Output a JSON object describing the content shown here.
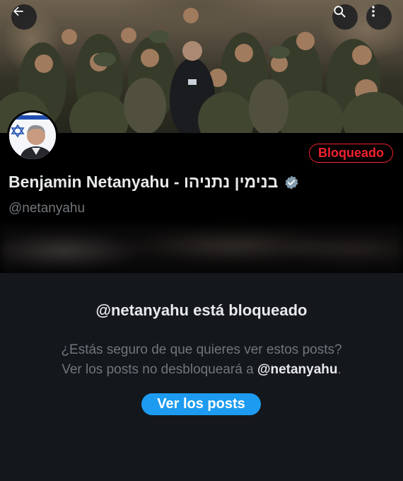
{
  "header": {
    "back_icon": "arrow-left-icon",
    "search_icon": "search-icon",
    "more_icon": "more-vertical-icon"
  },
  "banner": {
    "description_free": true
  },
  "profile": {
    "display_name": "Benjamin Netanyahu - בנימין נתניהו",
    "handle": "@netanyahu",
    "blocked_label": "Bloqueado",
    "verified_icon": "verified-badge-icon",
    "avatar_flag_icon": "israel-flag-icon"
  },
  "blocked_notice": {
    "title": "@netanyahu está bloqueado",
    "line1": "¿Estás seguro de que quieres ver estos posts?",
    "line2_prefix": "Ver los posts no desbloqueará a ",
    "line2_handle": "@netanyahu",
    "line2_suffix": ".",
    "button_label": "Ver los posts"
  },
  "colors": {
    "background": "#14171c",
    "profile_background": "#000000",
    "accent": "#1d9bf0",
    "blocked": "#f4212e",
    "muted_text": "#71767b",
    "primary_text": "#e7e9ea"
  }
}
